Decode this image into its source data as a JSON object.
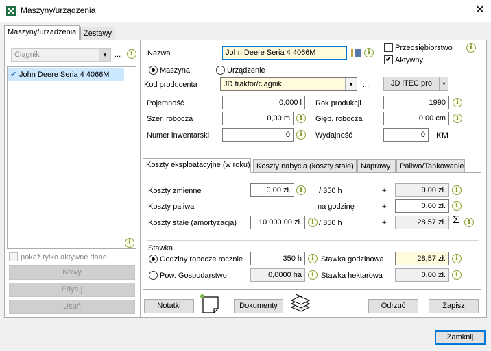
{
  "window": {
    "title": "Maszyny/urządzenia",
    "close_symbol": "✕"
  },
  "left_tabs": [
    "Maszyny/urządzenia",
    "Zestawy"
  ],
  "filter": {
    "category": "Ciągnik",
    "more": "..."
  },
  "machine_list": [
    {
      "check": "✔",
      "label": "John Deere Seria 4 4066M"
    }
  ],
  "left_footer": {
    "active_only_label": "pokaż tylko aktywne dane",
    "new_button": "Nowy",
    "edit_button": "Edytuj",
    "delete_button": "Usuń"
  },
  "form": {
    "name_label": "Nazwa",
    "name_value": "John Deere Seria 4 4066M",
    "enterprise_label": "Przedsiębiorstwo",
    "active_label": "Aktywny",
    "active_check": "✔",
    "type_machine": "Maszyna",
    "type_device": "Urządzenie",
    "producer_code_label": "Kod producenta",
    "producer_code_value": "JD traktor/ciągnik",
    "more": "...",
    "itec_button": "JD iTEC pro",
    "capacity_label": "Pojemność",
    "capacity_value": "0,000 l",
    "year_label": "Rok produkcji",
    "year_value": "1990",
    "width_label": "Szer. robocza",
    "width_value": "0,00 m",
    "depth_label": "Głęb. robocza",
    "depth_value": "0,00 cm",
    "inventory_label": "Numer inwentarski",
    "inventory_value": "0",
    "power_label": "Wydajność",
    "power_value": "0",
    "power_unit": "KM"
  },
  "cost_tabs": [
    "Koszty eksploatacyjne (w roku)",
    "Koszty nabycia (koszty stałe)",
    "Naprawy",
    "Paliwo/Tankowanie"
  ],
  "costs": {
    "variable_label": "Koszty zmienne",
    "variable_value": "0,00 zł.",
    "per_350h": "/ 350 h",
    "plus": "+",
    "variable_result": "0,00 zł.",
    "fuel_label": "Koszty paliwa",
    "per_hour": "na godzinę",
    "fuel_result": "0,00 zł.",
    "fixed_label": "Koszty stałe (amortyzacja)",
    "fixed_value": "10 000,00 zł.",
    "per_350h_2": "/ 350 h",
    "fixed_result": "28,57 zł.",
    "sum_symbol": "Σ"
  },
  "rate": {
    "group_label": "Stawka",
    "hours_label": "Godziny robocze rocznie",
    "hours_value": "350 h",
    "hourly_label": "Stawka godzinowa",
    "hourly_value": "28,57 zł.",
    "area_label": "Pow. Gospodarstwo",
    "area_value": "0,0000 ha",
    "hectare_label": "Stawka hektarowa",
    "hectare_value": "0,00 zł."
  },
  "bottom_buttons": {
    "notes": "Notatki",
    "documents": "Dokumenty",
    "cancel": "Odrzuć",
    "save": "Zapisz",
    "close": "Zamknij"
  },
  "info_symbol": "i",
  "dropdown_symbol": "▾",
  "colors": {
    "selection": "#cce8ff",
    "accent": "#0078d7",
    "yellow_field": "#fffbdc"
  }
}
